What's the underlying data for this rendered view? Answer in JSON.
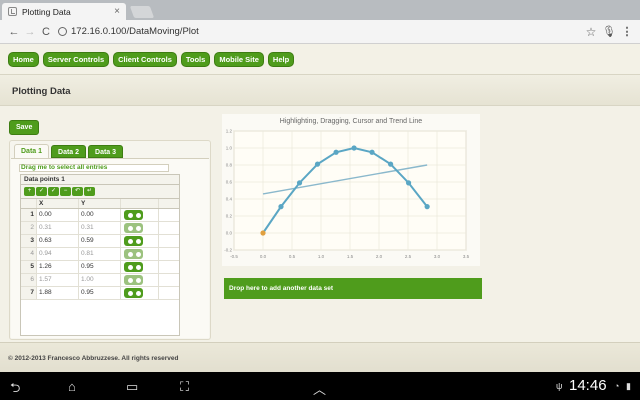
{
  "browser": {
    "tab_title": "Plotting Data",
    "tab_close": "×",
    "back": "←",
    "forward": "→",
    "reload": "C",
    "url": "172.16.0.100/DataMoving/Plot",
    "star": "☆",
    "mic": "🎙",
    "menu": "⋮"
  },
  "nav": {
    "items": [
      "Home",
      "Server Controls",
      "Client Controls",
      "Tools",
      "Mobile Site",
      "Help"
    ]
  },
  "page": {
    "title": "Plotting Data",
    "save_label": "Save",
    "tabs": [
      "Data 1",
      "Data 2",
      "Data 3"
    ],
    "drag_text": "Drag me to select all entries",
    "grid_title": "Data points 1",
    "tools": [
      "+",
      "✓",
      "✓",
      "−",
      "↶",
      "↵"
    ],
    "col_x": "X",
    "col_y": "Y",
    "rows": [
      {
        "idx": "1",
        "x": "0.00",
        "y": "0.00",
        "dim": false
      },
      {
        "idx": "2",
        "x": "0.31",
        "y": "0.31",
        "dim": true
      },
      {
        "idx": "3",
        "x": "0.63",
        "y": "0.59",
        "dim": false
      },
      {
        "idx": "4",
        "x": "0.94",
        "y": "0.81",
        "dim": true
      },
      {
        "idx": "5",
        "x": "1.26",
        "y": "0.95",
        "dim": false
      },
      {
        "idx": "6",
        "x": "1.57",
        "y": "1.00",
        "dim": true
      },
      {
        "idx": "7",
        "x": "1.88",
        "y": "0.95",
        "dim": false
      }
    ],
    "drop_text": "Drop here to add another data set",
    "footer": "© 2012-2013 Francesco Abbruzzese. All rights reserved"
  },
  "chart_data": {
    "type": "line",
    "title": "Highlighting, Dragging, Cursor and Trend Line",
    "xlim": [
      -0.5,
      3.5
    ],
    "ylim": [
      -0.2,
      1.2
    ],
    "xticks": [
      "-0.5",
      "0.0",
      "0.5",
      "1.0",
      "1.5",
      "2.0",
      "2.5",
      "3.0",
      "3.5"
    ],
    "yticks": [
      "-0.2",
      "0.0",
      "0.2",
      "0.4",
      "0.6",
      "0.8",
      "1.0",
      "1.2"
    ],
    "grid": true,
    "series": [
      {
        "x": [
          0.0,
          0.31,
          0.63,
          0.94,
          1.26,
          1.57,
          1.88,
          2.2,
          2.51,
          2.83
        ],
        "y": [
          0.0,
          0.31,
          0.59,
          0.81,
          0.95,
          1.0,
          0.95,
          0.81,
          0.59,
          0.31
        ],
        "color": "#5aa6c4",
        "highlight_index": 0,
        "highlight_color": "#e0a040"
      }
    ],
    "trend_line": {
      "x": [
        0.0,
        2.83
      ],
      "y": [
        0.46,
        0.8
      ],
      "color": "#8ab8cc"
    }
  },
  "android": {
    "back": "⮌",
    "home": "⌂",
    "recent": "▭",
    "screenshot": "⛶",
    "up": "︿",
    "usb": "ψ",
    "clock": "14:46",
    "wifi": "◔",
    "battery": "▮"
  }
}
